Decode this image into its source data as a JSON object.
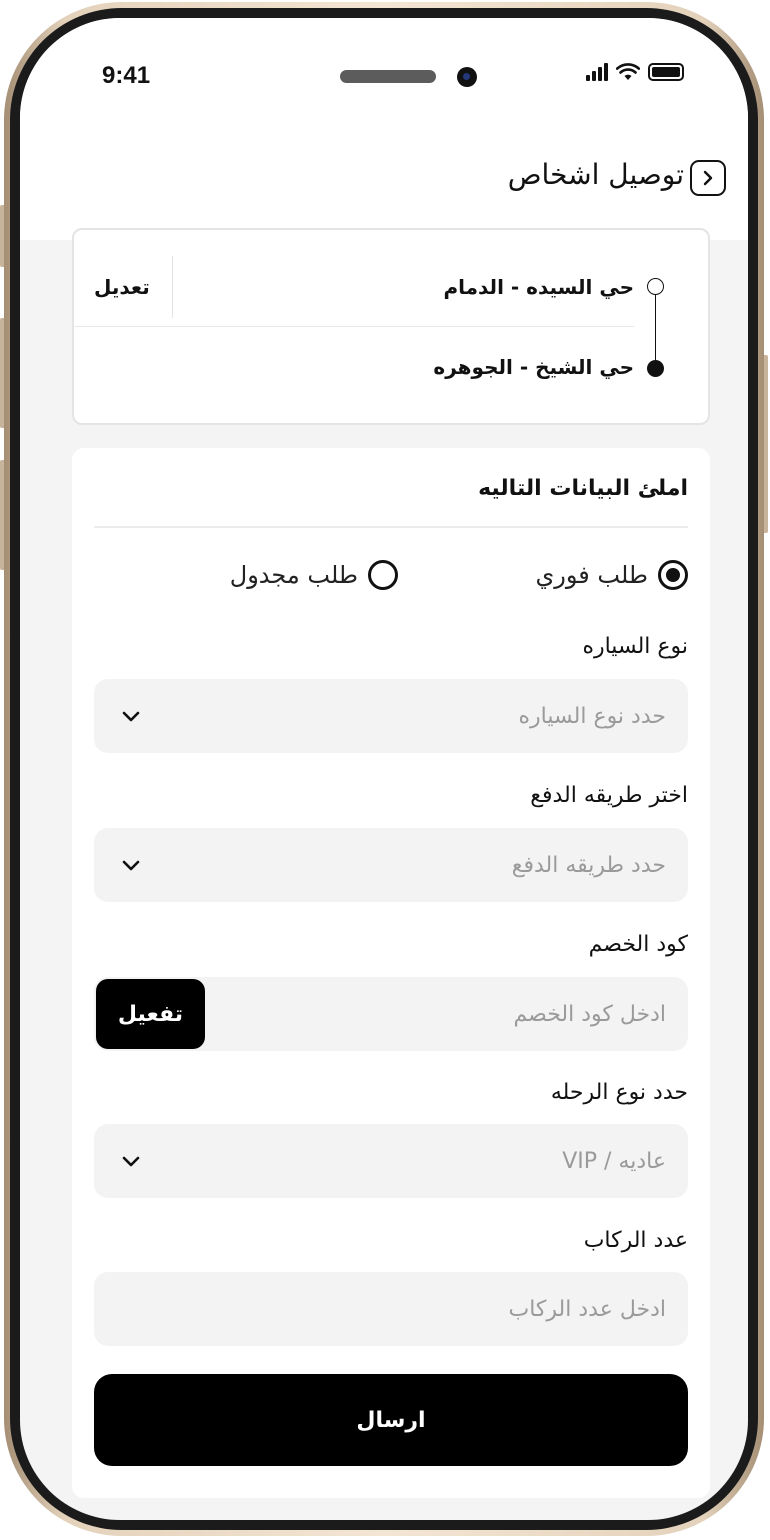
{
  "status_bar": {
    "time": "9:41"
  },
  "header": {
    "title": "توصيل اشخاص"
  },
  "route": {
    "from": "حي السيده - الدمام",
    "to": "حي الشيخ - الجوهره",
    "edit_label": "تعديل"
  },
  "form": {
    "heading": "املئ البيانات التاليه",
    "order_types": [
      {
        "label": "طلب فوري",
        "selected": true
      },
      {
        "label": "طلب مجدول",
        "selected": false
      }
    ],
    "car_type": {
      "label": "نوع السياره",
      "placeholder": "حدد نوع السياره"
    },
    "payment": {
      "label": "اختر طريقه الدفع",
      "placeholder": "حدد طريقه الدفع"
    },
    "discount": {
      "label": "كود الخصم",
      "placeholder": "ادخل كود الخصم",
      "activate_label": "تفعيل"
    },
    "trip_type": {
      "label": "حدد نوع الرحله",
      "placeholder": "عاديه / VIP"
    },
    "passengers": {
      "label": "عدد الركاب",
      "placeholder": "ادخل عدد الركاب"
    },
    "submit_label": "ارسال"
  }
}
